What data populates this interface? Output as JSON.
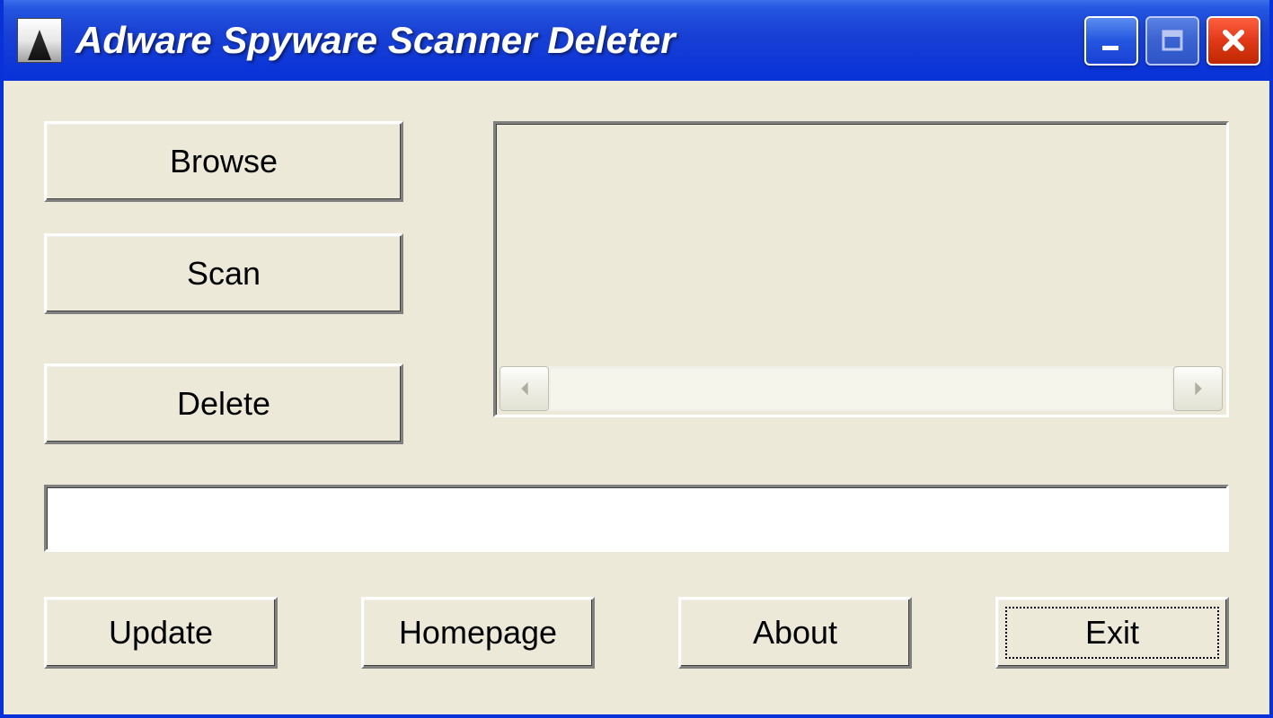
{
  "window": {
    "title": "Adware Spyware Scanner Deleter"
  },
  "buttons": {
    "browse": "Browse",
    "scan": "Scan",
    "delete": "Delete",
    "update": "Update",
    "homepage": "Homepage",
    "about": "About",
    "exit": "Exit"
  },
  "status": {
    "text": ""
  }
}
